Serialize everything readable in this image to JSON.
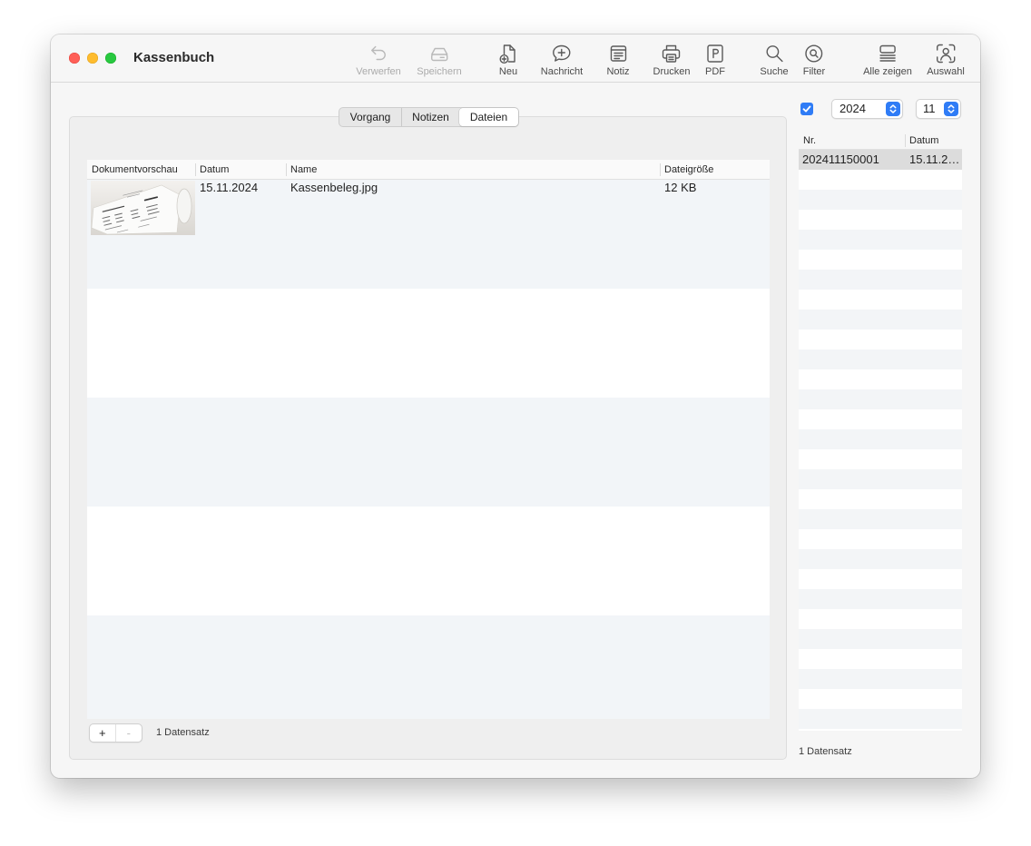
{
  "window": {
    "title": "Kassenbuch"
  },
  "toolbar": {
    "items": [
      {
        "label": "Verwerfen",
        "icon": "undo-icon",
        "disabled": true
      },
      {
        "label": "Speichern",
        "icon": "drive-icon",
        "disabled": true
      },
      {
        "label": "Neu",
        "icon": "new-document-icon",
        "disabled": false
      },
      {
        "label": "Nachricht",
        "icon": "new-message-icon",
        "disabled": false
      },
      {
        "label": "Notiz",
        "icon": "note-icon",
        "disabled": false
      },
      {
        "label": "Drucken",
        "icon": "printer-icon",
        "disabled": false
      },
      {
        "label": "PDF",
        "icon": "pdf-icon",
        "disabled": false
      },
      {
        "label": "Suche",
        "icon": "search-icon",
        "disabled": false
      },
      {
        "label": "Filter",
        "icon": "filter-icon",
        "disabled": false
      },
      {
        "label": "Alle zeigen",
        "icon": "show-all-icon",
        "disabled": false
      },
      {
        "label": "Auswahl",
        "icon": "person-selection-icon",
        "disabled": false
      }
    ]
  },
  "detail_tabs": {
    "items": [
      {
        "label": "Vorgang"
      },
      {
        "label": "Notizen"
      },
      {
        "label": "Dateien"
      }
    ],
    "selected_index": 2
  },
  "files_table": {
    "columns": [
      "Dokumentvorschau",
      "Datum",
      "Name",
      "Dateigröße"
    ],
    "rows": [
      {
        "date": "15.11.2024",
        "name": "Kassenbeleg.jpg",
        "size": "12 KB"
      }
    ],
    "add_button": "+",
    "remove_button": "-",
    "remove_enabled": false,
    "record_count": "1 Datensatz"
  },
  "filter": {
    "checked": true,
    "year": "2024",
    "month": "11"
  },
  "records_table": {
    "columns": [
      "Nr.",
      "Datum"
    ],
    "rows": [
      {
        "nr": "202411150001",
        "date": "15.11.2…",
        "selected": true
      }
    ],
    "record_count": "1 Datensatz"
  },
  "colors": {
    "accent": "#2f7cf6",
    "selection": "#dcdcdc",
    "row_stripe": "#f2f5f8",
    "close": "#ff5f57",
    "minimize": "#febc2e",
    "zoom": "#28c840"
  }
}
